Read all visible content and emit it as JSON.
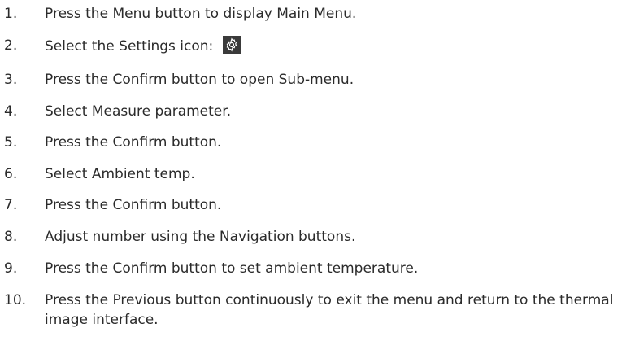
{
  "steps": [
    {
      "number": "1.",
      "text": "Press the Menu button to display Main Menu."
    },
    {
      "number": "2.",
      "text": "Select the Settings icon:",
      "icon": "settings-gear-icon"
    },
    {
      "number": "3.",
      "text": "Press the Confirm button to open Sub-menu."
    },
    {
      "number": "4.",
      "text": "Select Measure parameter."
    },
    {
      "number": "5.",
      "text": "Press the Confirm button."
    },
    {
      "number": "6.",
      "text": "Select Ambient temp."
    },
    {
      "number": "7.",
      "text": "Press the Confirm button."
    },
    {
      "number": "8.",
      "text": "Adjust number using the Navigation buttons."
    },
    {
      "number": "9.",
      "text": "Press the Confirm button to set ambient temperature."
    },
    {
      "number": "10.",
      "text": "Press the Previous button continuously to exit the menu and return to the thermal image interface."
    }
  ],
  "colors": {
    "text": "#2b2b2b",
    "icon_background": "#3a3a3a",
    "icon_foreground": "#ffffff"
  }
}
